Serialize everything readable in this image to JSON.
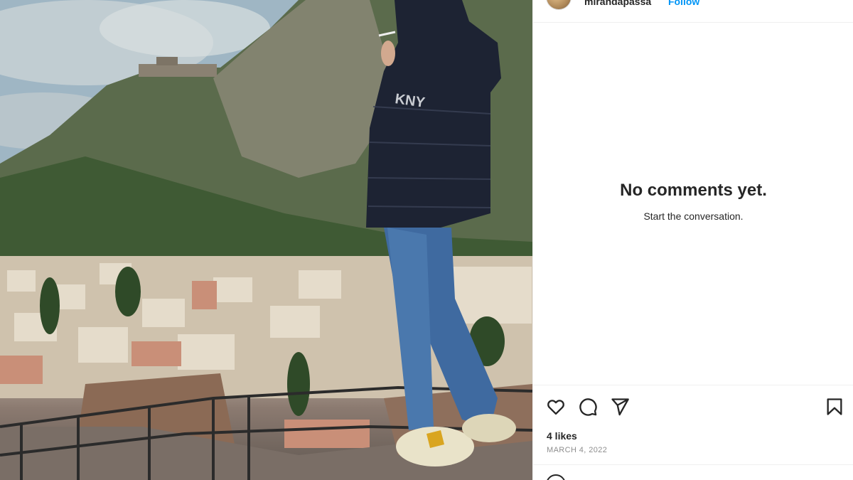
{
  "post": {
    "username": "mirandapassa",
    "follow_label": "Follow",
    "photo_alt": "Man in puffer jacket standing on ruins overlooking hillside town"
  },
  "comments": {
    "empty_title": "No comments yet.",
    "empty_subtitle": "Start the conversation."
  },
  "actions": {
    "like_icon": "heart-icon",
    "comment_icon": "comment-icon",
    "share_icon": "send-icon",
    "save_icon": "bookmark-icon",
    "likes_text": "4 likes",
    "date_text": "MARCH 4, 2022"
  },
  "colors": {
    "link_blue": "#0095f6",
    "text": "#262626",
    "muted": "#8e8e8e",
    "divider": "#efefef"
  }
}
